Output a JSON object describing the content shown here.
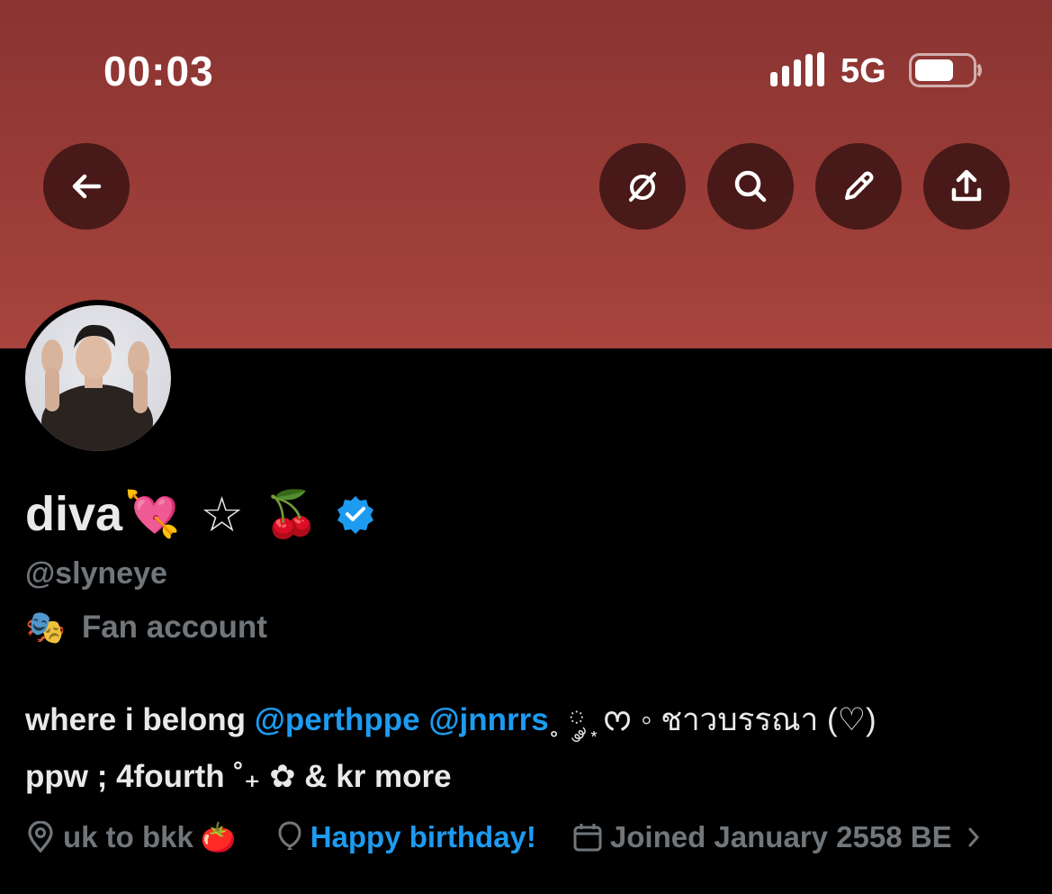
{
  "status_bar": {
    "time": "00:03",
    "network": "5G"
  },
  "nav": {
    "back_icon": "arrow-left-icon",
    "grok_icon": "grok-slash-circle-icon",
    "search_icon": "search-icon",
    "edit_icon": "pencil-icon",
    "share_icon": "share-upload-icon"
  },
  "profile": {
    "display_name": "diva",
    "name_emojis": [
      "💘",
      "☆",
      "🍒"
    ],
    "verified": true,
    "handle": "@slyneye",
    "category_icon": "🎭",
    "category": "Fan account",
    "bio": {
      "line1_prefix": "where i belong ",
      "mention1": "@perthppe",
      "mention2": "@jnnrrs",
      "line1_suffix": "˳ ༘ ͙ ᰔ ◦ ชาวบรรณา (♡)",
      "line2": "ppw ; 4fourth ˚₊ ✿ & kr more"
    },
    "location": "uk to bkk",
    "location_emoji": "🍅",
    "birthday": "Happy birthday!",
    "joined": "Joined January 2558 BE"
  },
  "colors": {
    "banner": "#9a3c37",
    "accent": "#1d9bf0",
    "muted": "#71767b",
    "text": "#e7e9ea"
  }
}
